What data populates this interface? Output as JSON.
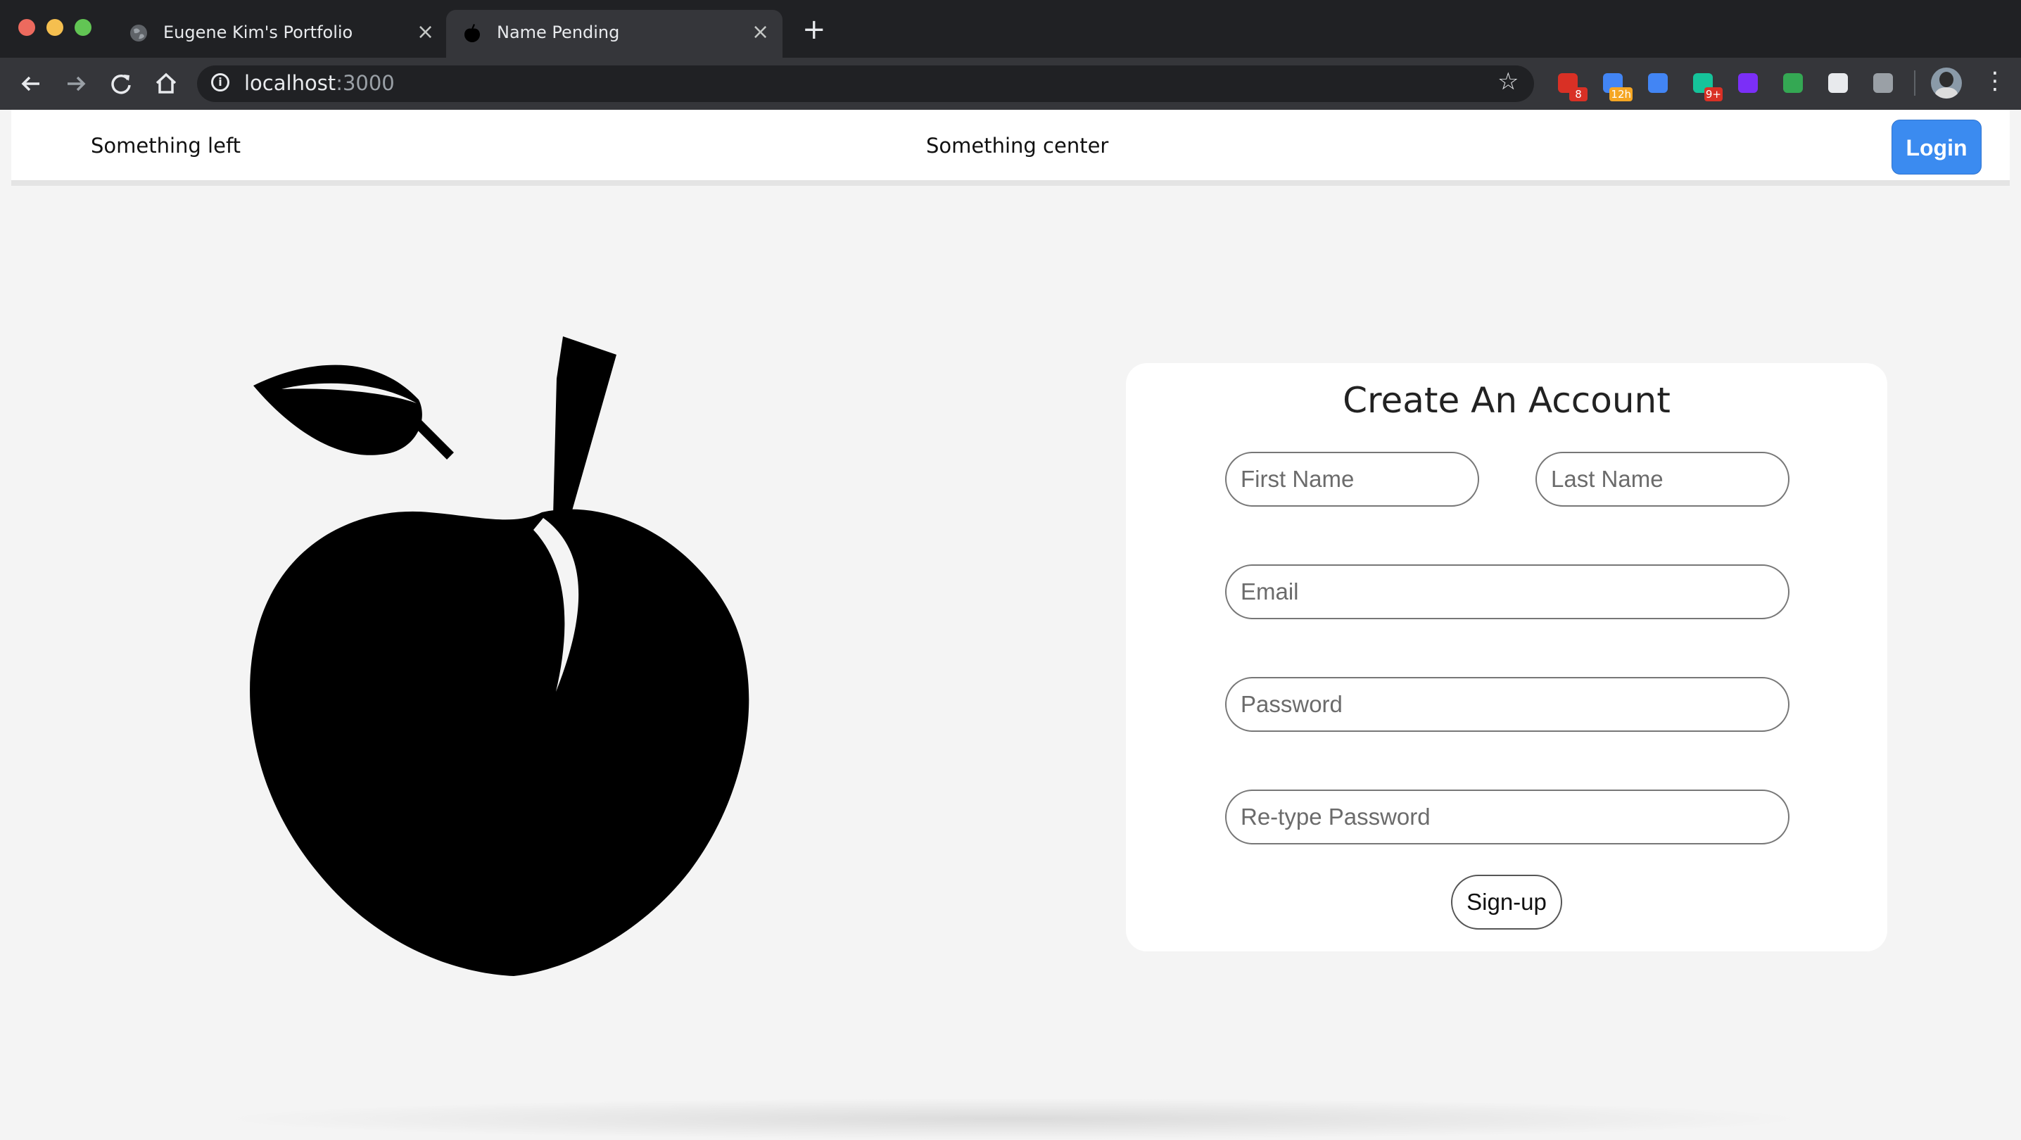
{
  "browser": {
    "tabs": [
      {
        "title": "Eugene Kim's Portfolio",
        "active": false
      },
      {
        "title": "Name Pending",
        "active": true
      }
    ],
    "url_host": "localhost",
    "url_port": ":3000",
    "extensions": [
      {
        "name": "gmail-extension-icon",
        "badge": "8",
        "color": "#d93025"
      },
      {
        "name": "calendar-extension-icon",
        "badge": "12h",
        "color": "#4285f4"
      },
      {
        "name": "translate-extension-icon",
        "badge": "",
        "color": "#4285f4"
      },
      {
        "name": "grammar-extension-icon",
        "badge": "9+",
        "color": "#15c39a"
      },
      {
        "name": "r-extension-icon",
        "badge": "",
        "color": "#7b2ff7"
      },
      {
        "name": "chat-extension-icon",
        "badge": "",
        "color": "#34a853"
      },
      {
        "name": "lens-extension-icon",
        "badge": "",
        "color": "#e8eaed"
      },
      {
        "name": "braces-extension-icon",
        "badge": "",
        "color": "#9aa0a6"
      }
    ]
  },
  "header": {
    "left_text": "Something left",
    "center_text": "Something center",
    "login_label": "Login"
  },
  "form": {
    "title": "Create An Account",
    "first_name_placeholder": "First Name",
    "last_name_placeholder": "Last Name",
    "email_placeholder": "Email",
    "password_placeholder": "Password",
    "retype_placeholder": "Re-type Password",
    "signup_label": "Sign-up"
  },
  "colors": {
    "accent": "#3b8bf0",
    "page_bg": "#f4f4f4",
    "card_bg": "#ffffff"
  }
}
